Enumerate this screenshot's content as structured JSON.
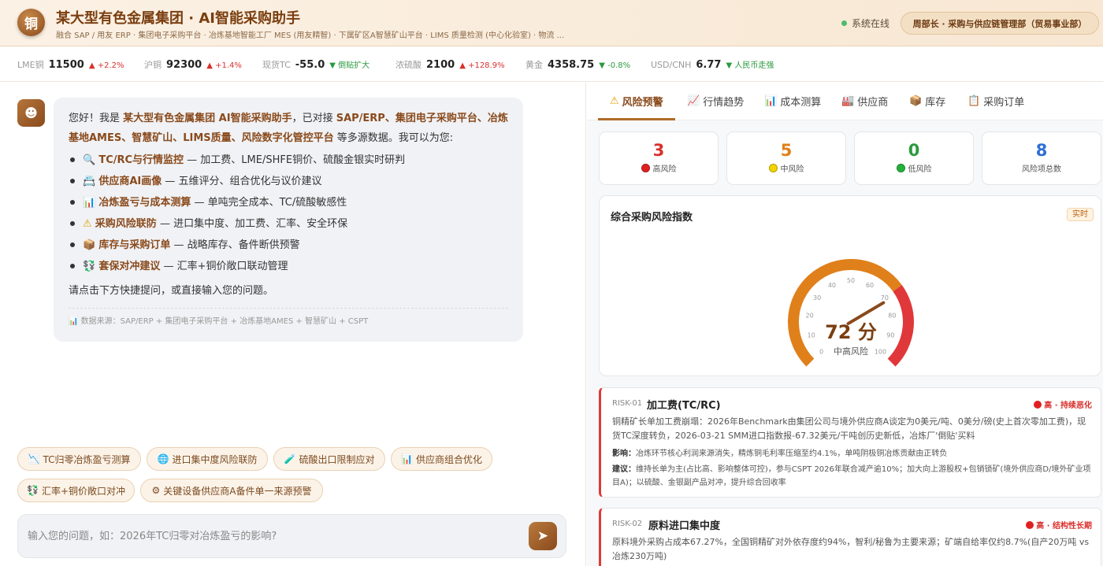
{
  "header": {
    "logo_char": "铜",
    "title": "某大型有色金属集团 · AI智能采购助手",
    "subtitle": "融合 SAP / 用友 ERP · 集团电子采购平台 · 冶炼基地智能工厂 MES (用友精智) · 下属矿区A智慧矿山平台 · LIMS 质量检测 (中心化验室) · 物流 ...",
    "status": "系统在线",
    "user": "周部长 · 采购与供应链管理部（贸易事业部）"
  },
  "ticker": [
    {
      "name": "LME铜",
      "value": "11500",
      "dir": "up",
      "arrow": "▲",
      "change": "+2.2%"
    },
    {
      "name": "沪铜",
      "value": "92300",
      "dir": "up",
      "arrow": "▲",
      "change": "+1.4%"
    },
    {
      "name": "现货TC",
      "value": "-55.0",
      "dir": "down",
      "arrow": "▼",
      "change": "倒贴扩大"
    },
    {
      "name": "浓硫酸",
      "value": "2100",
      "dir": "up",
      "arrow": "▲",
      "change": "+128.9%"
    },
    {
      "name": "黄金",
      "value": "4358.75",
      "dir": "down",
      "arrow": "▼",
      "change": "-0.8%"
    },
    {
      "name": "USD/CNH",
      "value": "6.77",
      "dir": "down",
      "arrow": "▼",
      "change": "人民币走强"
    }
  ],
  "chat": {
    "bot_icon": "☻",
    "intro_a": "您好！我是 ",
    "intro_b": "某大型有色金属集团 AI智能采购助手",
    "intro_c": "，已对接 ",
    "intro_d": "SAP/ERP、集团电子采购平台、冶炼基地AMES、智慧矿山、LIMS质量、风险数字化管控平台",
    "intro_e": " 等多源数据。我可以为您:",
    "items": [
      {
        "icon": "🔍",
        "title": "TC/RC与行情监控",
        "desc": " — 加工费、LME/SHFE铜价、硫酸金银实时研判"
      },
      {
        "icon": "📇",
        "title": "供应商AI画像",
        "desc": " — 五维评分、组合优化与议价建议"
      },
      {
        "icon": "📊",
        "title": "冶炼盈亏与成本测算",
        "desc": " — 单吨完全成本、TC/硫酸敏感性"
      },
      {
        "icon": "⚠",
        "title": "采购风险联防",
        "desc": " — 进口集中度、加工费、汇率、安全环保"
      },
      {
        "icon": "📦",
        "title": "库存与采购订单",
        "desc": " — 战略库存、备件断供预警"
      },
      {
        "icon": "💱",
        "title": "套保对冲建议",
        "desc": " — 汇率+铜价敞口联动管理"
      }
    ],
    "cta": "请点击下方快捷提问，或直接输入您的问题。",
    "source": "📊 数据来源：SAP/ERP + 集团电子采购平台 + 冶炼基地AMES + 智慧矿山 + CSPT",
    "quick": [
      {
        "icon": "📉",
        "label": "TC归零冶炼盈亏测算"
      },
      {
        "icon": "🌐",
        "label": "进口集中度风险联防"
      },
      {
        "icon": "🧪",
        "label": "硫酸出口限制应对"
      },
      {
        "icon": "📊",
        "label": "供应商组合优化"
      },
      {
        "icon": "💱",
        "label": "汇率+铜价敞口对冲"
      },
      {
        "icon": "⚙",
        "label": "关键设备供应商A备件单一来源预警"
      }
    ],
    "placeholder": "输入您的问题，如：2026年TC归零对冶炼盈亏的影响?",
    "send_icon": "➤"
  },
  "tabs": [
    {
      "icon": "⚠",
      "label": "风险预警"
    },
    {
      "icon": "📈",
      "label": "行情趋势"
    },
    {
      "icon": "📊",
      "label": "成本测算"
    },
    {
      "icon": "🏭",
      "label": "供应商"
    },
    {
      "icon": "📦",
      "label": "库存"
    },
    {
      "icon": "📋",
      "label": "采购订单"
    }
  ],
  "stats": [
    {
      "value": "3",
      "label": "高风险",
      "color": "#d9302c",
      "dot": "#e02020"
    },
    {
      "value": "5",
      "label": "中风险",
      "color": "#e0801a",
      "dot": "#f2d400"
    },
    {
      "value": "0",
      "label": "低风险",
      "color": "#2b9a3e",
      "dot": "#22b33a"
    },
    {
      "value": "8",
      "label": "风险项总数",
      "color": "#2f6fd6",
      "dot": ""
    }
  ],
  "gauge": {
    "title": "综合采购风险指数",
    "badge": "实时",
    "value": 72,
    "value_text": "72 分",
    "level": "中高风险",
    "min": 0,
    "max": 100,
    "ticks": [
      "0",
      "10",
      "20",
      "30",
      "40",
      "50",
      "60",
      "70",
      "80",
      "90",
      "100"
    ],
    "high_from": 70,
    "colors": {
      "normal": "#e0801a",
      "high": "#e0383a",
      "needle": "#8a4a1c"
    }
  },
  "risks": [
    {
      "id": "RISK-01",
      "name": "加工费(TC/RC)",
      "level": "高 · 持续恶化",
      "desc": "铜精矿长单加工费崩塌：2026年Benchmark由集团公司与境外供应商A谈定为0美元/吨、0美分/磅(史上首次零加工费)，现货TC深度转负，2026-03-21 SMM进口指数报-67.32美元/干吨创历史新低，冶炼厂'倒贴'买料",
      "impact_label": "影响：",
      "impact": "冶炼环节核心利润来源消失，精炼铜毛利率压缩至约4.1%，单吨阴极铜冶炼贡献由正转负",
      "advice_label": "建议：",
      "advice": "维持长单为主(占比高、影响整体可控)，参与CSPT 2026年联合减产逾10%；加大向上游股权+包销锁矿(境外供应商D/境外矿业项目A)；以硫酸、金银副产品对冲，提升综合回收率"
    },
    {
      "id": "RISK-02",
      "name": "原料进口集中度",
      "level": "高 · 结构性长期",
      "desc": "原料境外采购占成本67.27%，全国铜精矿对外依存度约94%，智利/秘鲁为主要来源；矿端自给率仅约8.7%(自产20万吨 vs 冶炼230万吨)"
    }
  ]
}
